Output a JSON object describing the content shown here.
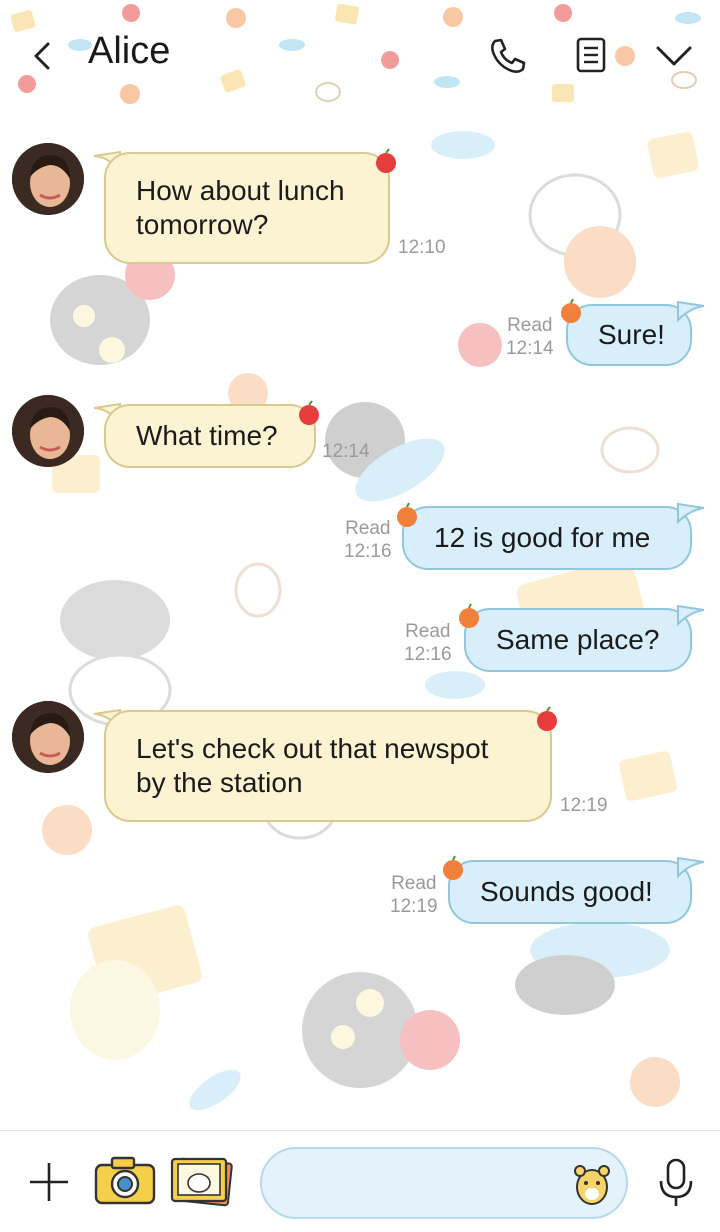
{
  "header": {
    "title": "Alice",
    "back_icon": "chevron-left-icon",
    "call_icon": "phone-icon",
    "notes_icon": "notes-icon",
    "menu_icon": "chevron-down-icon"
  },
  "messages": [
    {
      "direction": "incoming",
      "lines": [
        "How about lunch",
        "tomorrow?"
      ],
      "time": "12:10"
    },
    {
      "direction": "outgoing",
      "text": "Sure!",
      "read": "Read",
      "time": "12:14"
    },
    {
      "direction": "incoming",
      "text": "What time?",
      "time": "12:14"
    },
    {
      "direction": "outgoing",
      "text": "12 is good for me",
      "read": "Read",
      "time": "12:16"
    },
    {
      "direction": "outgoing",
      "text": "Same place?",
      "read": "Read",
      "time": "12:16"
    },
    {
      "direction": "incoming",
      "lines": [
        "Let's check out that newspot",
        "by the station"
      ],
      "time": "12:19"
    },
    {
      "direction": "outgoing",
      "text": "Sounds good!",
      "read": "Read",
      "time": "12:19"
    }
  ],
  "bottom_bar": {
    "add_icon": "plus-icon",
    "camera_icon": "camera-icon",
    "gallery_icon": "photo-gallery-icon",
    "input_value": "",
    "sticker_icon": "hamster-sticker-icon",
    "mic_icon": "microphone-icon"
  },
  "colors": {
    "incoming_bubble": "#fcf3d2",
    "outgoing_bubble": "#d8eefb",
    "timestamp": "#9a9a9a"
  }
}
